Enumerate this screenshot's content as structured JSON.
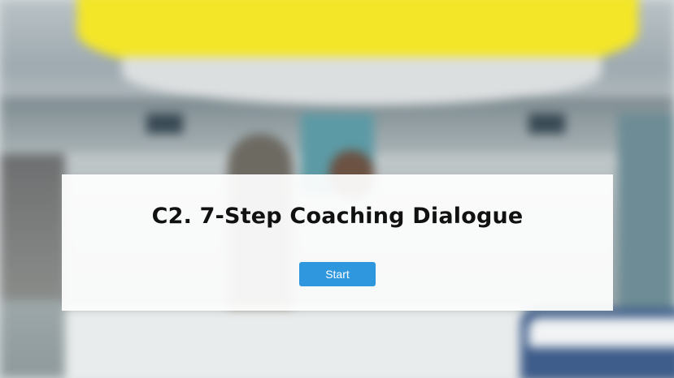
{
  "slide": {
    "title": "C2. 7-Step Coaching Dialogue",
    "start_label": "Start"
  },
  "colors": {
    "accent": "#2f97dd",
    "overlay": "#ffffff",
    "title_text": "#111111",
    "station_sign": "#f3e628"
  }
}
